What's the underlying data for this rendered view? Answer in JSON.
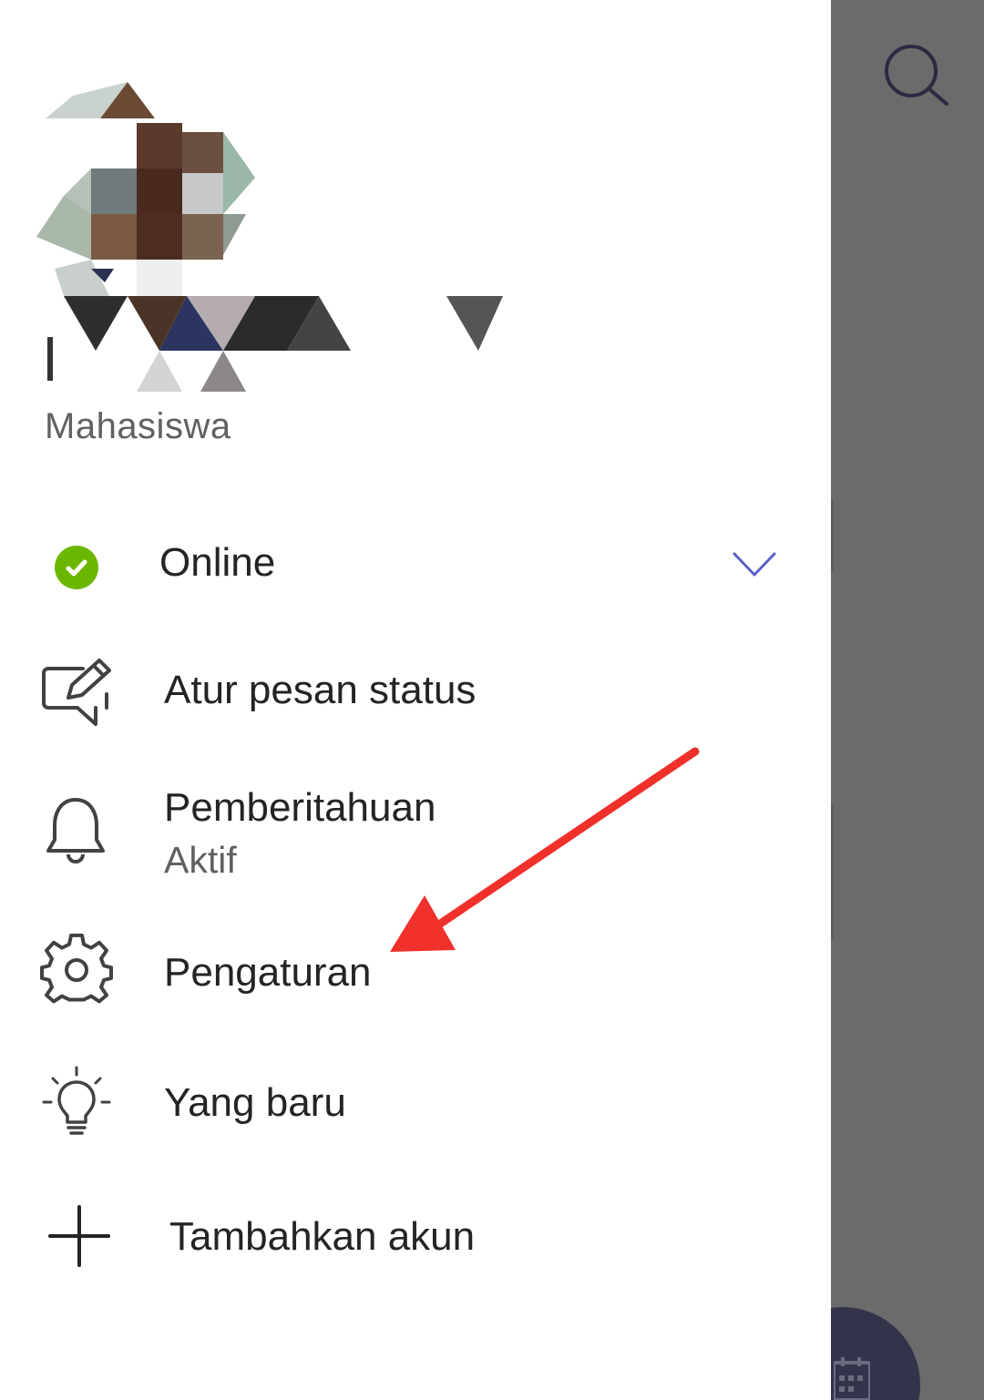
{
  "profile": {
    "role": "Mahasiswa"
  },
  "status": {
    "label": "Online",
    "color": "#6bb700"
  },
  "menu": {
    "set_status_message": "Atur pesan status",
    "notifications": "Pemberitahuan",
    "notifications_state": "Aktif",
    "settings": "Pengaturan",
    "whats_new": "Yang baru",
    "add_account": "Tambahkan akun"
  },
  "icons": {
    "status": "check-circle-icon",
    "status_expand": "chevron-down-icon",
    "set_status_message": "edit-message-icon",
    "notifications": "bell-icon",
    "settings": "gear-icon",
    "whats_new": "lightbulb-icon",
    "add_account": "plus-icon",
    "search": "search-icon",
    "fab": "calendar-icon"
  },
  "colors": {
    "accent": "#4f52b2",
    "online": "#6bb700",
    "overlay": "#6b6b6b",
    "annotation": "#f0302b"
  }
}
